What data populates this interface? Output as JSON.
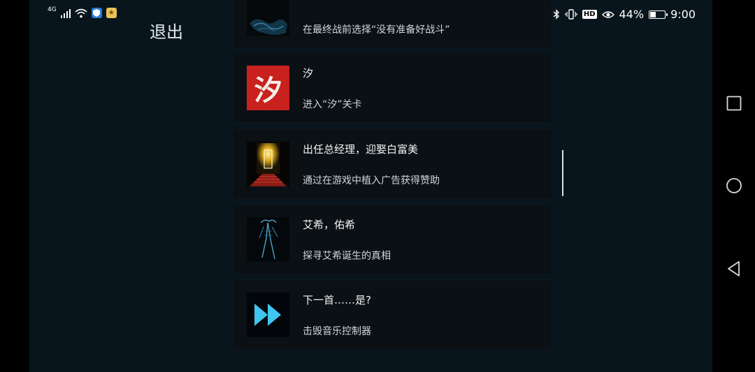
{
  "statusbar": {
    "network": "4G",
    "battery_percent": "44%",
    "time": "9:00",
    "hd_label": "HD",
    "battery_level": 0.44
  },
  "exit_label": "退出",
  "achievements": [
    {
      "title": "",
      "desc": "在最终战前选择“没有准备好战斗”",
      "icon": "blue-ink-icon"
    },
    {
      "title": "汐",
      "desc": "进入“汐”关卡",
      "icon": "xi-character-icon",
      "icon_text": "汐"
    },
    {
      "title": "出任总经理，迎娶白富美",
      "desc": "通过在游戏中植入广告获得赞助",
      "icon": "golden-door-icon"
    },
    {
      "title": "艾希，佑希",
      "desc": "探寻艾希诞生的真相",
      "icon": "skeletal-figure-icon"
    },
    {
      "title": "下一首……是?",
      "desc": "击毁音乐控制器",
      "icon": "fast-forward-icon"
    }
  ],
  "colors": {
    "background": "#08151c",
    "card": "#0b1014",
    "accent_red": "#c8211e",
    "accent_cyan": "#3fc6ee"
  }
}
